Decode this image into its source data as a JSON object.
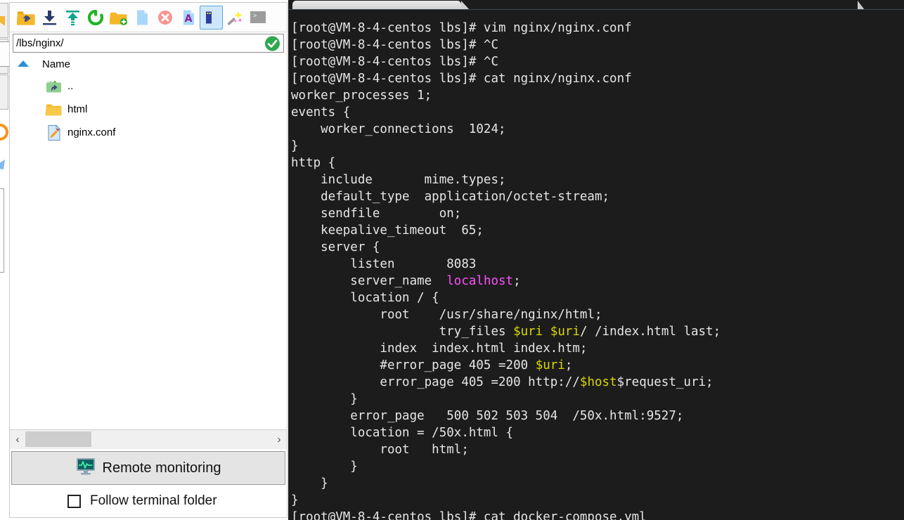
{
  "file_panel": {
    "toolbar": {
      "buttons": [
        {
          "name": "go-up-folder-icon",
          "tooltip": "Go to parent folder"
        },
        {
          "name": "download-icon",
          "tooltip": "Download"
        },
        {
          "name": "upload-icon",
          "tooltip": "Upload"
        },
        {
          "name": "refresh-icon",
          "tooltip": "Refresh"
        },
        {
          "name": "new-folder-icon",
          "tooltip": "New folder"
        },
        {
          "name": "new-file-icon",
          "tooltip": "New file"
        },
        {
          "name": "delete-icon",
          "tooltip": "Delete"
        },
        {
          "name": "rename-icon",
          "tooltip": "Rename"
        },
        {
          "name": "properties-icon",
          "tooltip": "Properties",
          "active": true
        },
        {
          "name": "magic-wand-icon",
          "tooltip": "Tools"
        },
        {
          "name": "open-terminal-icon",
          "tooltip": "Open terminal here"
        }
      ]
    },
    "path": {
      "value": "/lbs/nginx/",
      "placeholder": "/",
      "confirm_icon": "check-circle-icon"
    },
    "list": {
      "header": "Name",
      "sort_icon": "sort-ascending-icon",
      "rows": [
        {
          "icon": "parent-folder-icon",
          "label": ".."
        },
        {
          "icon": "folder-icon",
          "label": "html"
        },
        {
          "icon": "text-file-icon",
          "label": "nginx.conf"
        }
      ]
    },
    "hscroll": {
      "left_arrow": "‹",
      "right_arrow": "›"
    },
    "remote_monitoring": {
      "label": "Remote monitoring",
      "icon": "monitor-waveform-icon"
    },
    "follow_terminal": {
      "label": "Follow terminal folder",
      "checked": false
    }
  },
  "terminal": {
    "tabbar": {
      "active_tab_label": ""
    },
    "colors": {
      "background": "#1c1c1c",
      "foreground": "#e6e6e6",
      "variable": "#d7d700",
      "string": "#ff4fff"
    },
    "lines": [
      [
        {
          "t": "[root@VM-8-4-centos lbs]# vim nginx/nginx.conf"
        }
      ],
      [
        {
          "t": "[root@VM-8-4-centos lbs]# ^C"
        }
      ],
      [
        {
          "t": "[root@VM-8-4-centos lbs]# ^C"
        }
      ],
      [
        {
          "t": "[root@VM-8-4-centos lbs]# cat nginx/nginx.conf"
        }
      ],
      [
        {
          "t": "worker_processes 1;"
        }
      ],
      [
        {
          "t": "events {"
        }
      ],
      [
        {
          "t": "    worker_connections  1024;"
        }
      ],
      [
        {
          "t": "}"
        }
      ],
      [
        {
          "t": "http {"
        }
      ],
      [
        {
          "t": "    include       mime.types;"
        }
      ],
      [
        {
          "t": "    default_type  application/octet-stream;"
        }
      ],
      [
        {
          "t": "    sendfile        on;"
        }
      ],
      [
        {
          "t": "    keepalive_timeout  65;"
        }
      ],
      [
        {
          "t": "    server {"
        }
      ],
      [
        {
          "t": "        listen       8083"
        }
      ],
      [
        {
          "t": "        server_name  "
        },
        {
          "t": "localhost",
          "c": "magenta"
        },
        {
          "t": ";"
        }
      ],
      [
        {
          "t": "        location / {"
        }
      ],
      [
        {
          "t": "            root    /usr/share/nginx/html;"
        }
      ],
      [
        {
          "t": "                    try_files "
        },
        {
          "t": "$uri",
          "c": "yellow"
        },
        {
          "t": " "
        },
        {
          "t": "$uri",
          "c": "yellow"
        },
        {
          "t": "/ /index.html last;"
        }
      ],
      [
        {
          "t": "            index  index.html index.htm;"
        }
      ],
      [
        {
          "t": "            #error_page 405 =200 "
        },
        {
          "t": "$uri",
          "c": "yellow"
        },
        {
          "t": ";"
        }
      ],
      [
        {
          "t": "            error_page 405 =200 http://"
        },
        {
          "t": "$host",
          "c": "yellow"
        },
        {
          "t": "$request_uri;"
        }
      ],
      [
        {
          "t": "        }"
        }
      ],
      [
        {
          "t": "        error_page   500 502 503 504  /50x.html:9527;"
        }
      ],
      [
        {
          "t": "        location = /50x.html {"
        }
      ],
      [
        {
          "t": "            root   html;"
        }
      ],
      [
        {
          "t": "        }"
        }
      ],
      [
        {
          "t": "    }"
        }
      ],
      [
        {
          "t": "}"
        }
      ],
      [
        {
          "t": "[root@VM-8-4-centos lbs]# cat docker-compose.yml"
        }
      ]
    ]
  }
}
